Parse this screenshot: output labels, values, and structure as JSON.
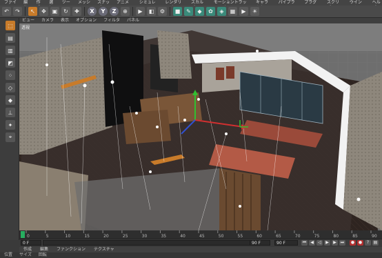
{
  "menubar": {
    "items": [
      "ファイル",
      "編集",
      "作成",
      "選択",
      "ツール",
      "メッシュ",
      "スナップ",
      "アニメート",
      "シミュレート",
      "レンダリング",
      "スカルプト",
      "モーショントラッキング",
      "キャラクタ",
      "パイプライン",
      "プラグイン",
      "スクリプト",
      "ウインドウ",
      "ヘルプ"
    ]
  },
  "toolbar": {
    "axis_x": "X",
    "axis_y": "Y",
    "axis_z": "Z"
  },
  "viewmenu": {
    "items": [
      "ビュー",
      "カメラ",
      "表示",
      "オプション",
      "フィルタ",
      "パネル"
    ]
  },
  "viewport": {
    "label": "透視"
  },
  "timeline": {
    "ticks": [
      "0",
      "5",
      "10",
      "15",
      "20",
      "25",
      "30",
      "35",
      "40",
      "45",
      "50",
      "55",
      "60",
      "65",
      "70",
      "75",
      "80",
      "85",
      "90"
    ]
  },
  "transport": {
    "start_frame": "0 F",
    "end_frame": "90 F",
    "end_frame_b": "90 F",
    "current_frame": "0 F"
  },
  "matmenu": {
    "items": [
      "作成",
      "編集",
      "ファンクション",
      "テクスチャ"
    ]
  },
  "bottom": {
    "items": [
      "位置",
      "サイズ",
      "回転"
    ]
  },
  "colors": {
    "accent": "#c87b2a",
    "record": "#b22f2f",
    "floor": "#2a2220"
  }
}
